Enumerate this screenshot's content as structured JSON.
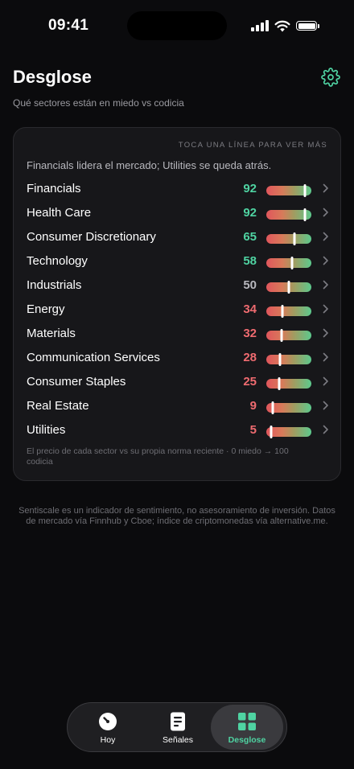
{
  "status_bar": {
    "time": "09:41"
  },
  "header": {
    "title": "Desglose",
    "subtitle": "Qué sectores están en miedo vs codicia",
    "settings_icon": "gear-icon"
  },
  "card": {
    "hint": "TOCA UNA LÍNEA PARA VER MÁS",
    "summary": "Financials lidera el mercado; Utilities se queda atrás.",
    "sectors": [
      {
        "name": "Financials",
        "score": 92
      },
      {
        "name": "Health Care",
        "score": 92
      },
      {
        "name": "Consumer Discretionary",
        "score": 65
      },
      {
        "name": "Technology",
        "score": 58
      },
      {
        "name": "Industrials",
        "score": 50
      },
      {
        "name": "Energy",
        "score": 34
      },
      {
        "name": "Materials",
        "score": 32
      },
      {
        "name": "Communication Services",
        "score": 28
      },
      {
        "name": "Consumer Staples",
        "score": 25
      },
      {
        "name": "Real Estate",
        "score": 9
      },
      {
        "name": "Utilities",
        "score": 5
      }
    ],
    "footnote": "El precio de cada sector vs su propia norma reciente · 0 miedo → 100 codicia"
  },
  "disclaimer": "Sentiscale es un indicador de sentimiento, no asesoramiento de inversión. Datos de mercado vía Finnhub y Cboe; índice de criptomonedas vía alternative.me.",
  "tabs": [
    {
      "label": "Hoy",
      "icon": "gauge-icon",
      "active": false
    },
    {
      "label": "Señales",
      "icon": "document-icon",
      "active": false
    },
    {
      "label": "Desglose",
      "icon": "grid-icon",
      "active": true
    }
  ],
  "colors": {
    "greed": "#4fd3a2",
    "neutral": "#b8b8be",
    "fear": "#ef6b70",
    "accent": "#4fd3a2"
  }
}
